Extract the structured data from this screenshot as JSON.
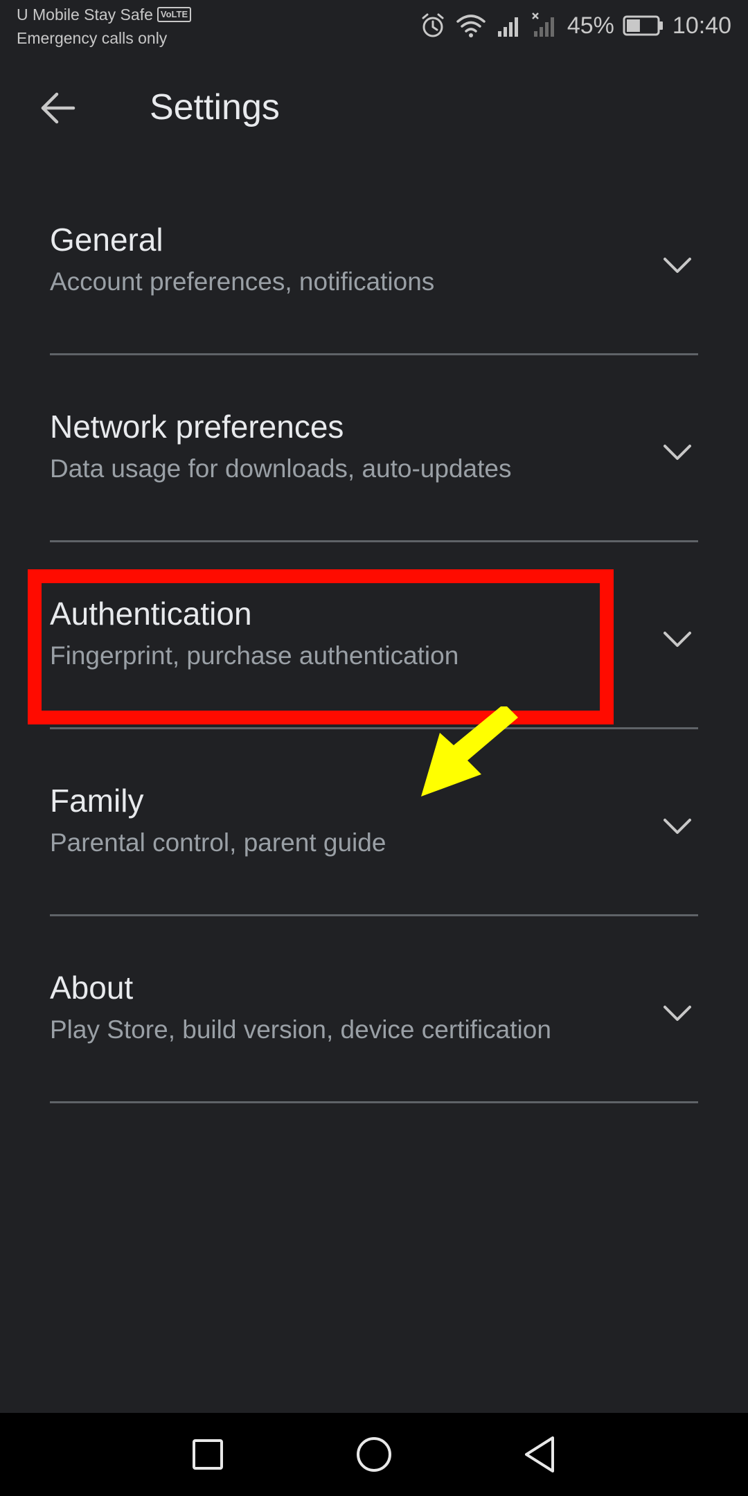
{
  "status_bar": {
    "carrier": "U Mobile Stay Safe",
    "volte_badge": "VoLTE",
    "network_status": "Emergency calls only",
    "battery_percent": "45%",
    "battery_level": 0.45,
    "time": "10:40",
    "icons": [
      "alarm-icon",
      "wifi-icon",
      "signal-icon",
      "no-signal-icon",
      "battery-icon"
    ]
  },
  "app_bar": {
    "back_icon": "arrow-back-icon",
    "title": "Settings"
  },
  "settings": {
    "items": [
      {
        "title": "General",
        "subtitle": "Account preferences, notifications"
      },
      {
        "title": "Network preferences",
        "subtitle": "Data usage for downloads, auto-updates"
      },
      {
        "title": "Authentication",
        "subtitle": "Fingerprint, purchase authentication"
      },
      {
        "title": "Family",
        "subtitle": "Parental control, parent guide"
      },
      {
        "title": "About",
        "subtitle": "Play Store, build version, device certification"
      }
    ],
    "expand_icon": "chevron-down-icon"
  },
  "annotations": {
    "highlight_color": "#ff0b00",
    "arrow_color": "#ffff00",
    "highlighted_item": "Authentication"
  },
  "nav_bar": {
    "buttons": [
      "recent-apps-icon",
      "home-icon",
      "back-triangle-icon"
    ]
  },
  "colors": {
    "background": "#202124",
    "primary_text": "#e8eaed",
    "secondary_text": "#9aa0a6",
    "divider": "#5f6368"
  }
}
